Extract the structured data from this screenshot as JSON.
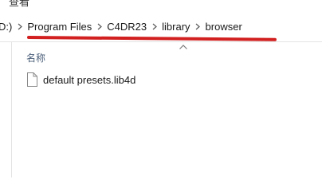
{
  "top": {
    "partial_text": "查看"
  },
  "breadcrumb": {
    "items": [
      {
        "label": "D:)"
      },
      {
        "label": "Program Files"
      },
      {
        "label": "C4DR23"
      },
      {
        "label": "library"
      },
      {
        "label": "browser"
      }
    ]
  },
  "file_list": {
    "column_header": "名称",
    "files": [
      {
        "name": "default presets.lib4d"
      }
    ]
  },
  "colors": {
    "annotation": "#d21f1f",
    "header_text": "#4c607a"
  }
}
